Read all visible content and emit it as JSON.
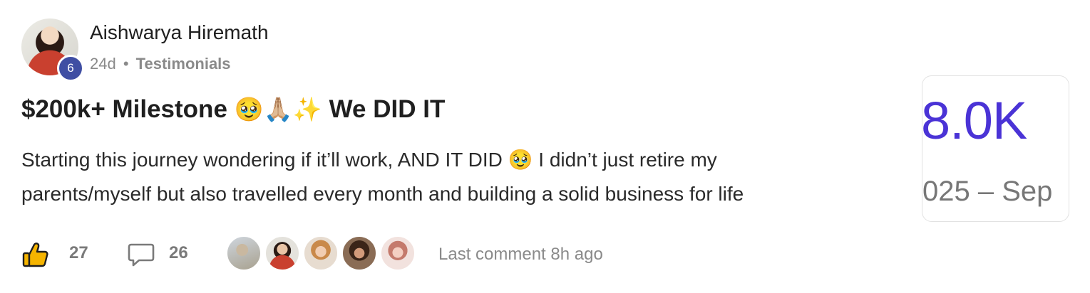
{
  "author": {
    "name": "Aishwarya Hiremath",
    "level": "6",
    "age": "24d",
    "separator": "•",
    "category": "Testimonials"
  },
  "post": {
    "title_text": "$200k+ Milestone",
    "title_emoji": "🥹🙏🏼✨",
    "title_tail": "We DID IT",
    "body_line1": "Starting this journey wondering if it’ll work, AND IT DID 🥹 I didn’t just retire my",
    "body_line2": "parents/myself but also travelled every month and building a solid business for life"
  },
  "thumbnail": {
    "big_text": "8.0K",
    "small_text": "025 – Sep",
    "accent": "#4a33d6"
  },
  "footer": {
    "like_icon": "thumbs-up-icon",
    "likes": "27",
    "comment_icon": "speech-bubble-icon",
    "comments": "26",
    "commenter_avatars": [
      "avatar-1",
      "avatar-2",
      "avatar-3",
      "avatar-4",
      "avatar-5"
    ],
    "last_comment": "Last comment 8h ago"
  }
}
